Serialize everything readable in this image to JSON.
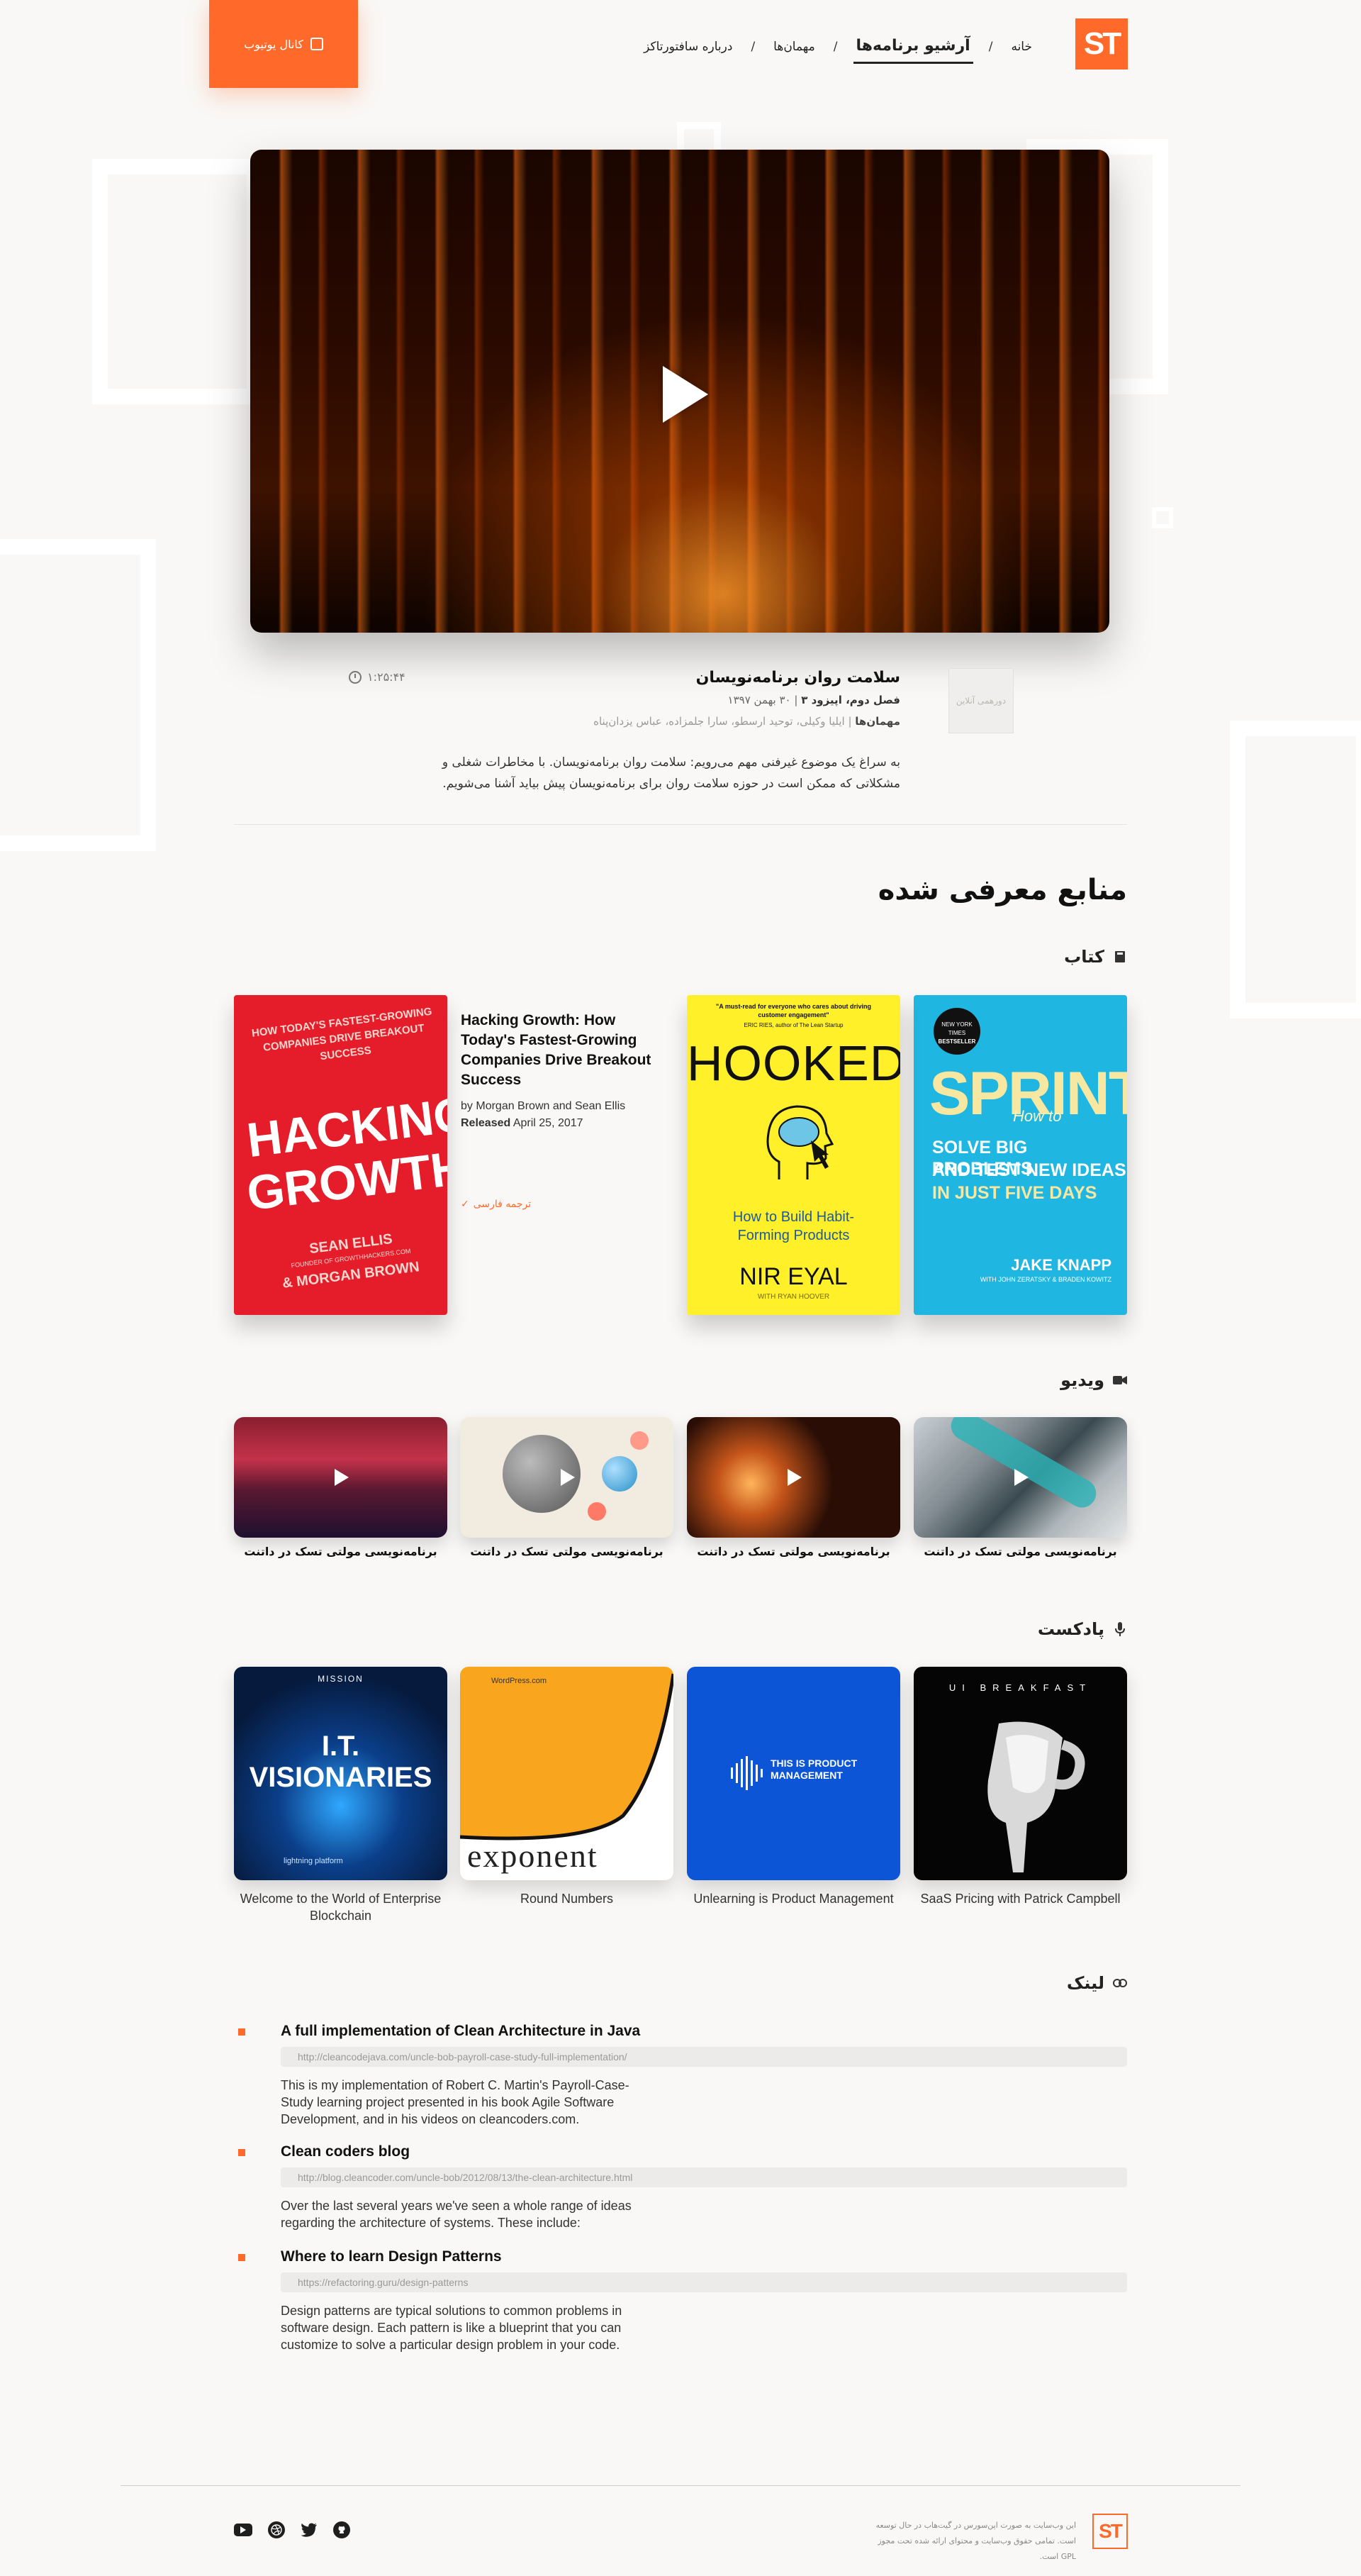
{
  "header": {
    "logo_text": "ST",
    "nav": [
      {
        "label": "خانه"
      },
      {
        "label": "آرشیو برنامه‌ها",
        "active": true
      },
      {
        "label": "مهمان‌ها"
      },
      {
        "label": "درباره سافتورتاکز"
      }
    ],
    "nav_separator": "/",
    "youtube_button": "کانال یوتیوب"
  },
  "episode": {
    "thumb_label": "دورهمی آنلاین",
    "title": "سلامت روان برنامه‌نویسان",
    "season": "فصل دوم،",
    "episode": " اپیزود ۳",
    "date": " | ۳۰ بهمن ۱۳۹۷",
    "guests_label": "مهمان‌ها",
    "guests": " | ایلیا وکیلی، توحید ارسطو، سارا جلمزاده، عباس یزدان‌پناه",
    "duration": "۱:۲۵:۴۴",
    "description": "به سراغ یک موضوع غیرفنی مهم می‌رویم: سلامت روان برنامه‌نویسان. با مخاطرات شغلی و مشکلاتی که ممکن است در حوزه سلامت روان برای برنامه‌نویسان پیش بیاید آشنا می‌شویم."
  },
  "resources": {
    "title": "منابع معرفی شده",
    "books_heading": "کتاب",
    "books": [
      {
        "title": "Hacking Growth: How Today's Fastest-Growing Companies Drive Breakout Success",
        "by_label": "by",
        "authors": "Morgan Brown and Sean Ellis",
        "released_label": "Released",
        "released": "April 25, 2017",
        "translation": "ترجمه فارسی"
      }
    ],
    "sprint_cover": {
      "badge_top": "NEW YORK TIMES",
      "badge_bottom": "BESTSELLER",
      "title": "SPRINT",
      "line1": "How to",
      "line2": "SOLVE BIG PROBLEMS",
      "line3": "AND TEST NEW IDEAS",
      "line4": "IN JUST FIVE DAYS",
      "author": "JAKE KNAPP",
      "coauthors": "WITH JOHN ZERATSKY & BRADEN KOWITZ"
    },
    "hooked_cover": {
      "quote": "\"A must-read for everyone who cares about driving customer engagement\"",
      "quote_by": "ERIC RIES, author of The Lean Startup",
      "title": "HOOKED",
      "subtitle": "How to Build Habit-Forming Products",
      "author": "NIR EYAL",
      "coauthor": "WITH RYAN HOOVER"
    },
    "hacking_cover": {
      "tagline": "HOW TODAY'S FASTEST-GROWING COMPANIES DRIVE BREAKOUT SUCCESS",
      "title1": "HACKING",
      "title2": "GROWTH",
      "author1": "SEAN ELLIS",
      "author1_note": "FOUNDER OF GROWTHHACKERS.COM",
      "author2": "& MORGAN BROWN"
    },
    "videos_heading": "ویدیو",
    "videos": [
      {
        "caption": "برنامه‌نویسی مولتی تسک در داتنت"
      },
      {
        "caption": "برنامه‌نویسی مولتی تسک در داتنت"
      },
      {
        "caption": "برنامه‌نویسی مولتی تسک در داتنت"
      },
      {
        "caption": "برنامه‌نویسی مولتی تسک در داتنت"
      }
    ],
    "podcasts_heading": "پادکست",
    "podcasts": [
      {
        "caption": "SaaS Pricing with Patrick Campbell",
        "art_text": "UI BREAKFAST"
      },
      {
        "caption": "Unlearning is Product Management",
        "art_text": "THIS IS PRODUCT MANAGEMENT"
      },
      {
        "caption": "Round Numbers",
        "art_text": "exponent",
        "art_sub": "WordPress.com"
      },
      {
        "caption": "Welcome to the World of Enterprise Blockchain",
        "art_text": "I.T. VISIONARIES",
        "art_sub": "MISSION",
        "art_sponsor": "lightning platform"
      }
    ],
    "links_heading": "لینک",
    "links": [
      {
        "title": "A full implementation of Clean Architecture in Java",
        "url": "http://cleancodejava.com/uncle-bob-payroll-case-study-full-implementation/",
        "description": "This is my implementation of Robert C. Martin's Payroll-Case-Study learning project presented in his book Agile Software Development, and in his videos on cleancoders.com."
      },
      {
        "title": "Clean coders blog",
        "url": "http://blog.cleancoder.com/uncle-bob/2012/08/13/the-clean-architecture.html",
        "description": "Over the last several years we've seen a whole range of ideas regarding the architecture of systems. These include:"
      },
      {
        "title": "Where to learn Design Patterns",
        "url": "https://refactoring.guru/design-patterns",
        "description": "Design patterns are typical solutions to common problems in software design. Each pattern is like a blueprint that you can customize to solve a particular design problem in your code."
      }
    ]
  },
  "footer": {
    "logo_text": "ST",
    "text": "این وب‌سایت به صورت اپن‌سورس در گیت‌هاب در حال توسعه است. تمامی حقوق وب‌سایت و محتوای ارائه شده تحت مجوز GPL است.",
    "socials": [
      {
        "icon": "github-icon"
      },
      {
        "icon": "twitter-icon"
      },
      {
        "icon": "dribbble-icon"
      },
      {
        "icon": "youtube-icon"
      }
    ]
  },
  "colors": {
    "accent": "#ff6a2a",
    "background": "#f9f8f6"
  }
}
